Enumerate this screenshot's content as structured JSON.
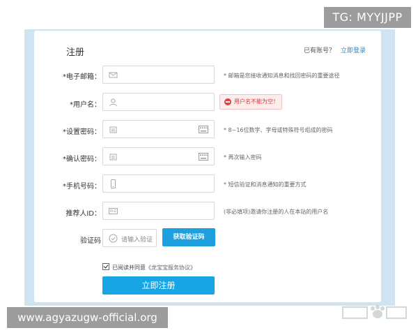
{
  "watermark_top": "TG: MYYJJPP",
  "watermark_bottom": "www.agyazugw-official.org",
  "form": {
    "title": "注册",
    "has_account": "已有账号？",
    "login_link": "立即登录",
    "fields": {
      "email": {
        "label": "*电子邮箱：",
        "hint": "* 邮箱是您接收通知消息和找回密码的重要途径"
      },
      "username": {
        "label": "*用户名：",
        "error": "用户名不能为空！"
      },
      "password": {
        "label": "*设置密码：",
        "hint": "* 8~16位数字、字母或特殊符号组成的密码"
      },
      "confirm": {
        "label": "*确认密码：",
        "hint": "* 再次输入密码"
      },
      "phone": {
        "label": "*手机号码：",
        "hint": "* 短信验证和消息通知的重要方式"
      },
      "referrer": {
        "label": "推荐人ID：",
        "hint": "(非必填项)邀请你注册的人在本站的用户名"
      }
    },
    "captcha": {
      "label": "验证码",
      "placeholder": "请输入验证",
      "button": "获取验证码"
    },
    "agree_text": "已阅读并同意",
    "protocol": "《龙宝宝服务协议》",
    "submit": "立即注册"
  },
  "colors": {
    "accent": "#1e9fe0",
    "error": "#d23b3b",
    "outer_bg": "#cfe3f1"
  }
}
